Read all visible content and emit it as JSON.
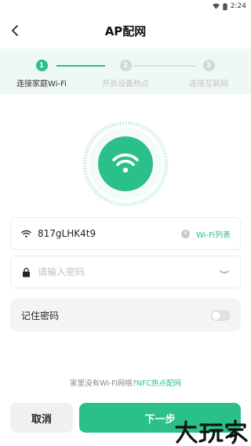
{
  "status_bar": {
    "time": "2:24"
  },
  "header": {
    "title": "AP配网"
  },
  "stepper": {
    "steps": [
      {
        "num": "1",
        "label": "连接家庭Wi-Fi"
      },
      {
        "num": "2",
        "label": "开启设备热点"
      },
      {
        "num": "3",
        "label": "连接互联网"
      }
    ],
    "current_step": 1
  },
  "form": {
    "ssid_value": "817gLHK4t9",
    "wifi_list_label": "Wi-Fi列表",
    "password_placeholder": "请输入密码",
    "password_value": ""
  },
  "remember": {
    "label": "记住密码",
    "enabled": false
  },
  "hint": {
    "text": "家里没有Wi-Fi网络?",
    "link": "NFC热点配网"
  },
  "buttons": {
    "cancel": "取消",
    "next": "下一步"
  },
  "watermark": {
    "text": "大玩家"
  },
  "colors": {
    "accent": "#2bbf8a",
    "accent_light": "#eef8f4",
    "inactive": "#d6d6d6"
  },
  "icons": [
    "back-icon",
    "wifi-icon",
    "lock-icon",
    "clear-icon",
    "eye-closed-icon",
    "battery-icon",
    "signal-icon"
  ]
}
